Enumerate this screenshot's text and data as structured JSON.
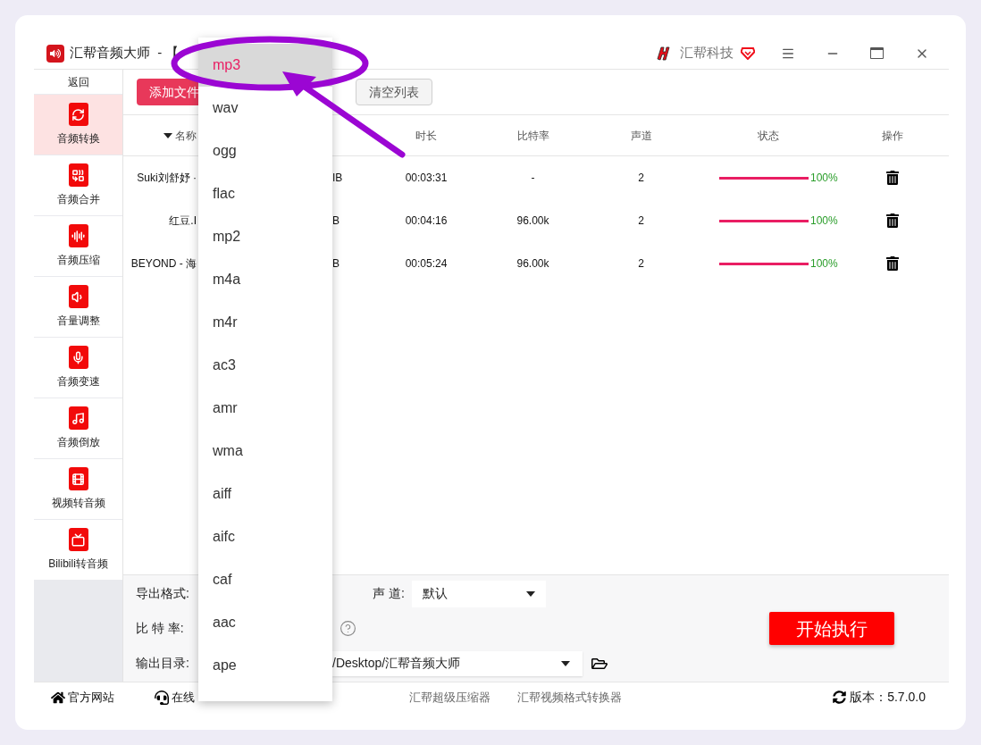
{
  "window": {
    "title": "汇帮音频大师  - 【",
    "brand": "汇帮科技"
  },
  "sidebar": {
    "back": "返回",
    "items": [
      {
        "label": "音频转换",
        "kind": "convert",
        "selected": true
      },
      {
        "label": "音频合并",
        "kind": "merge",
        "selected": false
      },
      {
        "label": "音频压缩",
        "kind": "compress",
        "selected": false
      },
      {
        "label": "音量调整",
        "kind": "volume",
        "selected": false
      },
      {
        "label": "音频变速",
        "kind": "mic",
        "selected": false
      },
      {
        "label": "音频倒放",
        "kind": "note",
        "selected": false
      },
      {
        "label": "视频转音频",
        "kind": "film",
        "selected": false
      },
      {
        "label": "Bilibili转音频",
        "kind": "tv",
        "selected": false
      }
    ]
  },
  "toolbar": [
    {
      "label": "添加文件",
      "kind": "primary"
    },
    {
      "label": "清空列表",
      "kind": "secondary"
    }
  ],
  "table": {
    "columns": [
      {
        "label": "名称",
        "sorted": true
      },
      {
        "label": "时长",
        "sorted": false
      },
      {
        "label": "比特率",
        "sorted": false
      },
      {
        "label": "声道",
        "sorted": false
      },
      {
        "label": "状态",
        "sorted": false
      },
      {
        "label": "操作",
        "sorted": false
      }
    ],
    "rows": [
      {
        "name": "Suki刘舒妤 ·",
        "size": "IB",
        "duration": "00:03:31",
        "bitrate": "-",
        "channels": "2",
        "level": 1,
        "status": "100%"
      },
      {
        "name": "红豆.I",
        "size": "B",
        "duration": "00:04:16",
        "bitrate": "96.00k",
        "channels": "2",
        "level": 1,
        "status": "100%"
      },
      {
        "name": "BEYOND - 海",
        "size": "B",
        "duration": "00:05:24",
        "bitrate": "96.00k",
        "channels": "2",
        "level": 1,
        "status": "100%"
      }
    ]
  },
  "settings": {
    "format_label": "导出格式:",
    "channel_label": "声 道:",
    "channel_value": "默认",
    "bitrate_label": "比 特 率:",
    "output_label": "输出目录:",
    "output_value": "/Desktop/汇帮音频大师",
    "start": "开始执行"
  },
  "footer": {
    "links": [
      {
        "label": "官方网站",
        "kind": "home"
      },
      {
        "label": "在线",
        "kind": "support"
      }
    ],
    "products": [
      "汇帮超级压缩器",
      "汇帮视频格式转换器"
    ],
    "version": "版本：5.7.0.0"
  },
  "dropdown": {
    "options": [
      {
        "label": "mp3",
        "selected": true
      },
      {
        "label": "wav",
        "selected": false
      },
      {
        "label": "ogg",
        "selected": false
      },
      {
        "label": "flac",
        "selected": false
      },
      {
        "label": "mp2",
        "selected": false
      },
      {
        "label": "m4a",
        "selected": false
      },
      {
        "label": "m4r",
        "selected": false
      },
      {
        "label": "ac3",
        "selected": false
      },
      {
        "label": "amr",
        "selected": false
      },
      {
        "label": "wma",
        "selected": false
      },
      {
        "label": "aiff",
        "selected": false
      },
      {
        "label": "aifc",
        "selected": false
      },
      {
        "label": "caf",
        "selected": false
      },
      {
        "label": "aac",
        "selected": false
      },
      {
        "label": "ape",
        "selected": false
      }
    ]
  }
}
